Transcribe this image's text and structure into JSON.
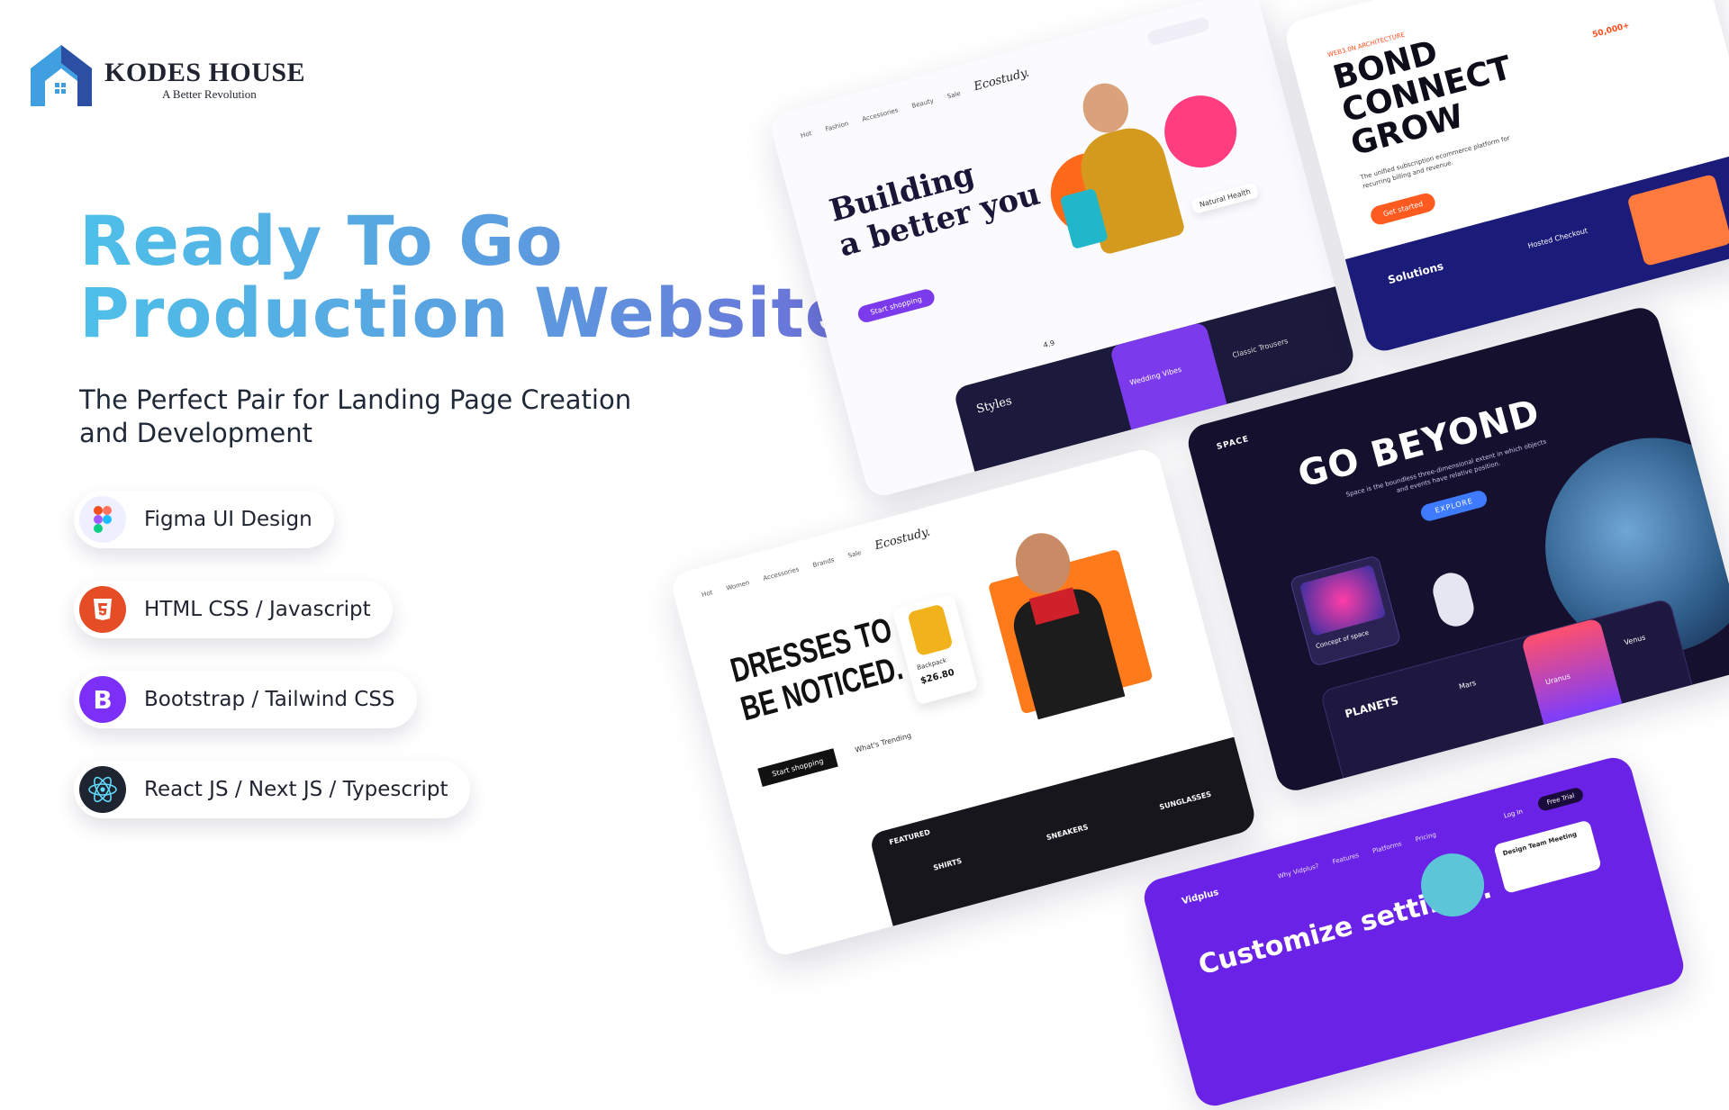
{
  "brand": {
    "name": "KODES HOUSE",
    "tagline": "A Better Revolution",
    "colors": {
      "primary": "#3f9fe0",
      "dark": "#2c4fa3"
    }
  },
  "hero": {
    "headline_line1": "Ready To Go",
    "headline_line2": "Production Website",
    "subheadline": "The Perfect Pair for Landing Page Creation and Development",
    "gradient": [
      "#4ec0e8",
      "#6c6fd8"
    ]
  },
  "features": [
    {
      "label": "Figma UI Design",
      "icon": "figma-icon"
    },
    {
      "label": "HTML CSS / Javascript",
      "icon": "html5-icon",
      "color": "#e44d26"
    },
    {
      "label": "Bootstrap / Tailwind CSS",
      "icon": "bootstrap-icon",
      "color": "#7b2ff7"
    },
    {
      "label": "React JS / Next JS / Typescript",
      "icon": "react-icon",
      "color": "#1f2530"
    }
  ],
  "mockups": {
    "ecostudy": {
      "logo": "Ecostudy.",
      "nav": [
        "Hot",
        "Fashion",
        "Accessories",
        "Beauty",
        "Sale"
      ],
      "headline_line1": "Building",
      "headline_line2": "a better you",
      "cta": "Start shopping",
      "card_labels": [
        "Styles",
        "Wedding Vibes",
        "Classic Trousers"
      ],
      "badge": "Natural Health",
      "rating": "4.9"
    },
    "bond": {
      "eyebrow": "WEB3.0N ARCHITECTURE",
      "headline_line1": "BOND",
      "headline_line2": "CONNECT",
      "headline_line3": "GROW",
      "description": "The unified subscription ecommerce platform for recurring billing and revenue.",
      "cta": "Get started",
      "stat": "50,000+",
      "band_title": "Solutions",
      "band_item": "Hosted Checkout"
    },
    "space": {
      "logo": "SPACE",
      "headline": "GO BEYOND",
      "description": "Space is the boundless three-dimensional extent in which objects and events have relative position.",
      "cta": "EXPLORE",
      "card_title": "Concept of space",
      "planets_title": "PLANETS",
      "planet_names": [
        "Mars",
        "Uranus",
        "Venus"
      ],
      "bg": "#15102e",
      "accent": "#7b4dff"
    },
    "dresses": {
      "logo": "Ecostudy.",
      "nav": [
        "Hot",
        "Women",
        "Accessories",
        "Brands",
        "Sale"
      ],
      "headline_line1": "DRESSES TO",
      "headline_line2": "BE NOTICED.",
      "cta": "Start shopping",
      "secondary_cta": "What's Trending",
      "product": "Backpack",
      "price": "$26.80",
      "featured_label": "FEATURED",
      "categories": [
        "SHIRTS",
        "SNEAKERS",
        "SUNGLASSES"
      ]
    },
    "vidplus": {
      "logo": "Vidplus",
      "nav": [
        "Why Vidplus?",
        "Features",
        "Platforms",
        "Pricing"
      ],
      "login": "Log In",
      "signup": "Free Trial",
      "headline": "Customize settings.",
      "card_title": "Design Team Meeting",
      "bg": "#6a22e6"
    }
  }
}
